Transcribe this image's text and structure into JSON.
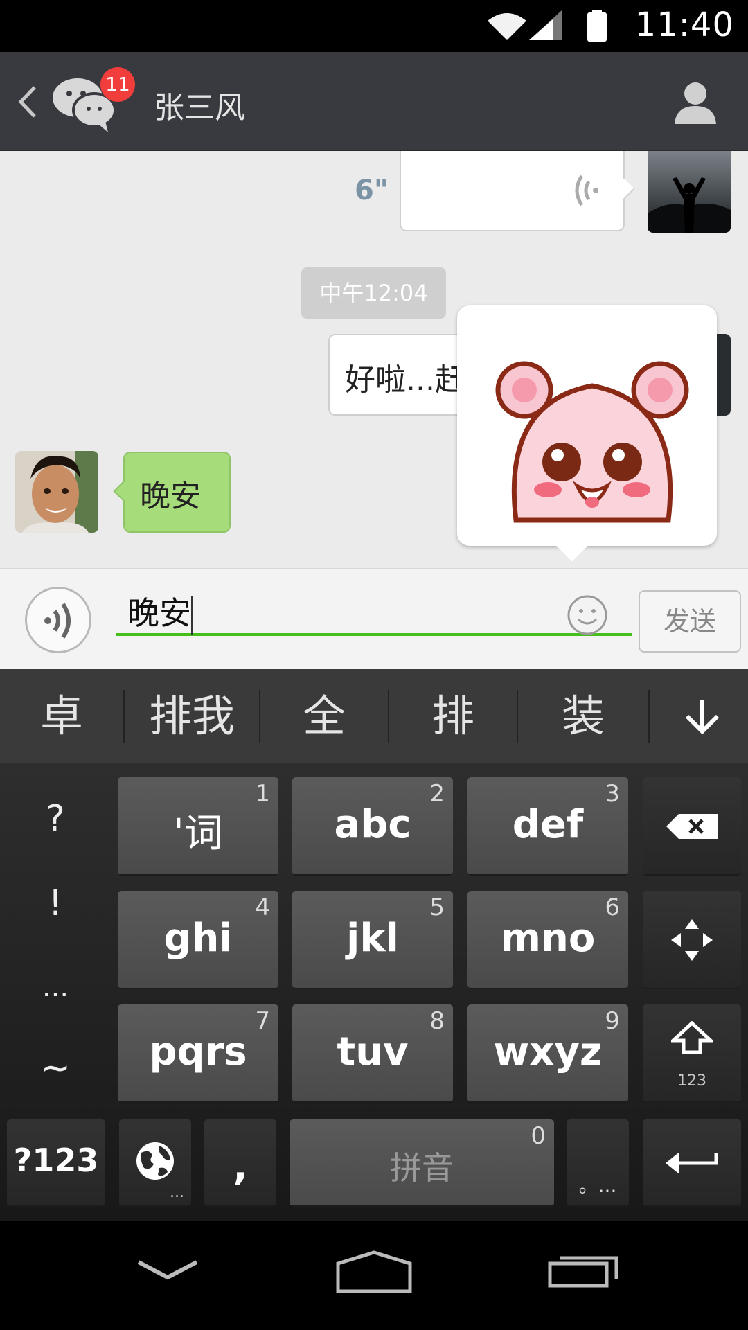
{
  "status_bar": {
    "time": "11:40"
  },
  "header": {
    "back_icon": "back-chevron-icon",
    "unread_badge": "11",
    "contact_name": "张三风",
    "profile_icon": "person-icon"
  },
  "chat": {
    "voice_message": {
      "duration": "6\"",
      "icon": "voice-wave-icon"
    },
    "timestamp": "中午12:04",
    "sent_text": "好啦...赶快",
    "received_text": "晚安"
  },
  "input_bar": {
    "text": "晚安",
    "send_label": "发送",
    "emoji_icon": "smiley-icon",
    "voice_icon": "voice-input-icon"
  },
  "candidates": [
    "卓",
    "排我",
    "全",
    "排",
    "装"
  ],
  "keyboard": {
    "symbols": [
      "?",
      "!",
      "...",
      "~"
    ],
    "keys": [
      {
        "label": "'词",
        "num": "1"
      },
      {
        "label": "abc",
        "num": "2"
      },
      {
        "label": "def",
        "num": "3"
      },
      {
        "label": "ghi",
        "num": "4"
      },
      {
        "label": "jkl",
        "num": "5"
      },
      {
        "label": "mno",
        "num": "6"
      },
      {
        "label": "pqrs",
        "num": "7"
      },
      {
        "label": "tuv",
        "num": "8"
      },
      {
        "label": "wxyz",
        "num": "9"
      }
    ],
    "shift_sub": "123",
    "mode_label": "?123",
    "globe_sub": "...",
    "comma": ",",
    "space_label": "拼音",
    "space_num": "0",
    "period": "。..."
  },
  "colors": {
    "accent_green": "#45c01a",
    "received_bubble": "#a6dc7a",
    "badge_red": "#f23d3d",
    "header_bg": "#393a3f"
  }
}
